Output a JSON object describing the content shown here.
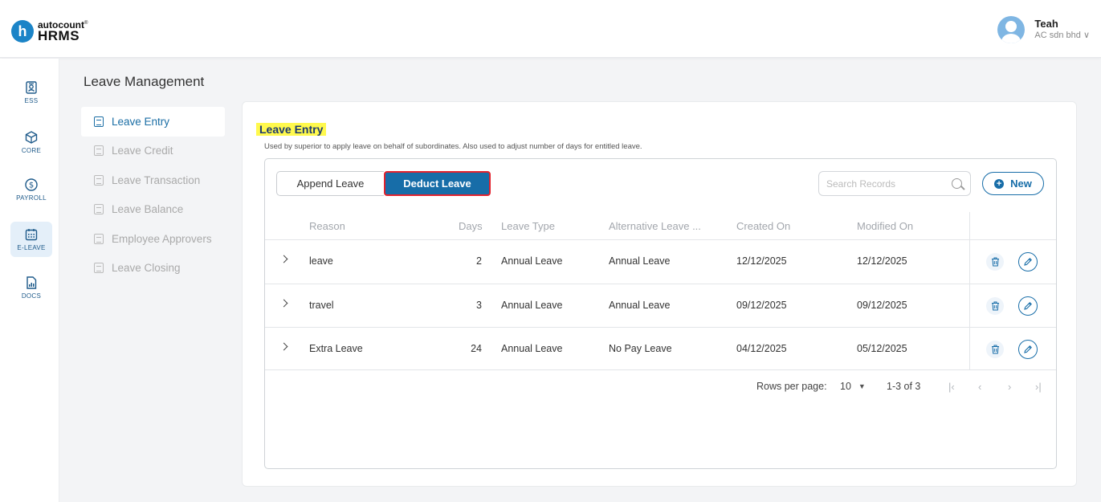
{
  "header": {
    "logo_letter": "h",
    "logo_brand": "autocount",
    "logo_mark": "®",
    "logo_product": "HRMS",
    "user_name": "Teah",
    "user_company": "AC sdn bhd ∨"
  },
  "sidebar": {
    "items": [
      {
        "label": "ESS",
        "icon": "id-card-icon"
      },
      {
        "label": "CORE",
        "icon": "cube-icon"
      },
      {
        "label": "PAYROLL",
        "icon": "dollar-coin-icon"
      },
      {
        "label": "E-LEAVE",
        "icon": "calendar-icon",
        "active": true
      },
      {
        "label": "DOCS",
        "icon": "document-chart-icon"
      }
    ]
  },
  "section_title": "Leave Management",
  "menu": {
    "items": [
      {
        "label": "Leave Entry",
        "active": true
      },
      {
        "label": "Leave Credit"
      },
      {
        "label": "Leave Transaction"
      },
      {
        "label": "Leave Balance"
      },
      {
        "label": "Employee Approvers"
      },
      {
        "label": "Leave Closing"
      }
    ]
  },
  "card": {
    "title": "Leave Entry",
    "description": "Used by superior to apply leave on behalf of subordinates. Also used to adjust number of days for entitled leave."
  },
  "toolbar": {
    "append_label": "Append Leave",
    "deduct_label": "Deduct Leave",
    "search_placeholder": "Search Records",
    "new_label": "New"
  },
  "table": {
    "columns": [
      "Reason",
      "Days",
      "Leave Type",
      "Alternative Leave ...",
      "Created On",
      "Modified On"
    ],
    "rows": [
      {
        "reason": "leave",
        "days": "2",
        "leave_type": "Annual Leave",
        "alt_leave": "Annual Leave",
        "created": "12/12/2025",
        "modified": "12/12/2025"
      },
      {
        "reason": "travel",
        "days": "3",
        "leave_type": "Annual Leave",
        "alt_leave": "Annual Leave",
        "created": "09/12/2025",
        "modified": "09/12/2025"
      },
      {
        "reason": "Extra Leave",
        "days": "24",
        "leave_type": "Annual Leave",
        "alt_leave": "No Pay Leave",
        "created": "04/12/2025",
        "modified": "05/12/2025"
      }
    ]
  },
  "pagination": {
    "rows_per_page_label": "Rows per page:",
    "rows_per_page_value": "10",
    "range": "1-3 of 3"
  },
  "colors": {
    "primary": "#176da8",
    "highlight": "#fff94d",
    "deduct_border": "#e3222d"
  }
}
